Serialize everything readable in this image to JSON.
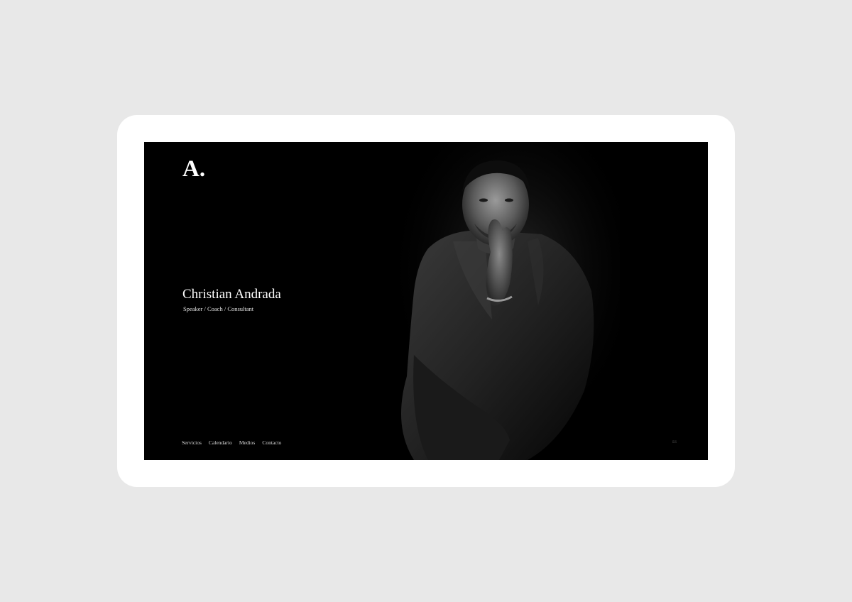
{
  "logo": {
    "text": "A."
  },
  "hero": {
    "name": "Christian Andrada",
    "tagline": "Speaker / Coach / Consultant"
  },
  "nav": {
    "items": [
      {
        "label": "Servicios"
      },
      {
        "label": "Calendario"
      },
      {
        "label": "Medios"
      },
      {
        "label": "Contacto"
      }
    ]
  },
  "corner": {
    "text": "ES"
  },
  "colors": {
    "background": "#e8e8e8",
    "frame": "#ffffff",
    "screen": "#000000",
    "text": "#ffffff"
  },
  "portrait": {
    "icon": "portrait-photo"
  }
}
